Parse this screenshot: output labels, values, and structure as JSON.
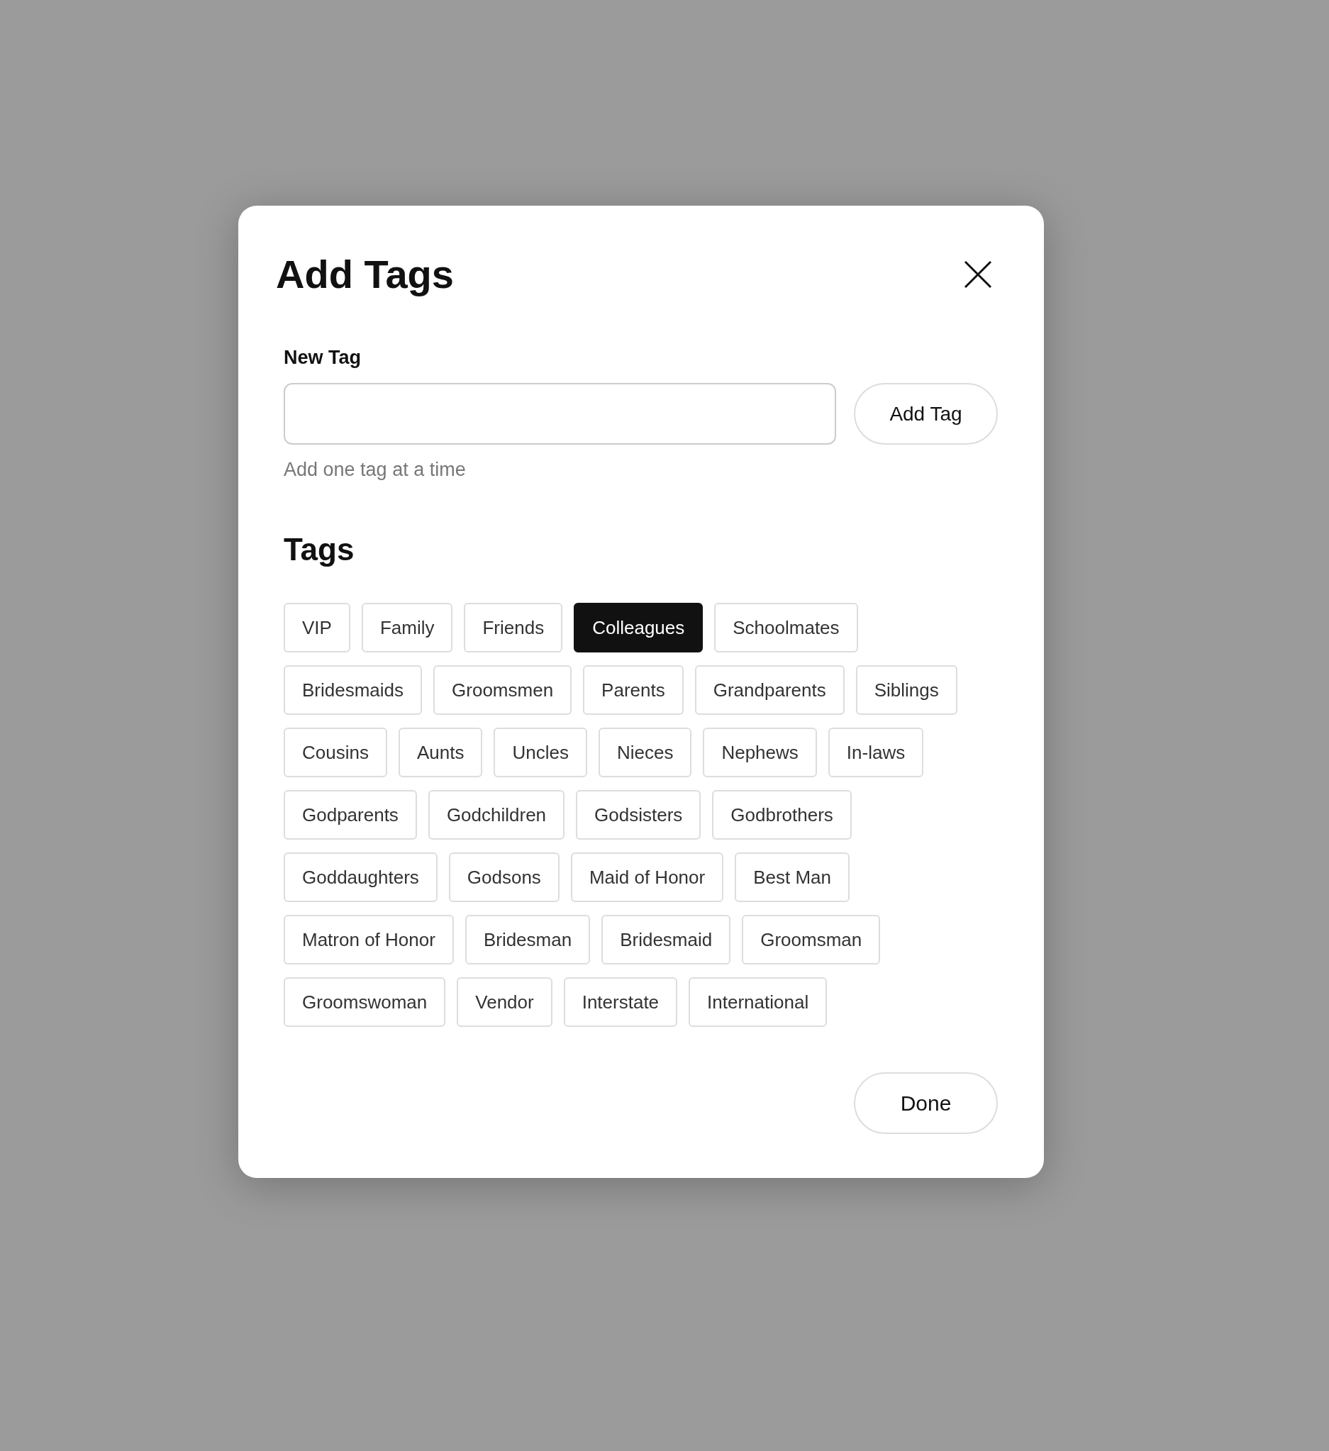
{
  "dialog": {
    "title": "Add Tags"
  },
  "new_tag": {
    "label": "New Tag",
    "button": "Add Tag",
    "hint": "Add one tag at a time"
  },
  "tags": {
    "heading": "Tags",
    "rows": [
      [
        {
          "label": "VIP",
          "selected": false
        },
        {
          "label": "Family",
          "selected": false
        },
        {
          "label": "Friends",
          "selected": false
        },
        {
          "label": "Colleagues",
          "selected": true
        },
        {
          "label": "Schoolmates",
          "selected": false
        }
      ],
      [
        {
          "label": "Bridesmaids",
          "selected": false
        },
        {
          "label": "Groomsmen",
          "selected": false
        },
        {
          "label": "Parents",
          "selected": false
        },
        {
          "label": "Grandparents",
          "selected": false
        },
        {
          "label": "Siblings",
          "selected": false
        }
      ],
      [
        {
          "label": "Cousins",
          "selected": false
        },
        {
          "label": "Aunts",
          "selected": false
        },
        {
          "label": "Uncles",
          "selected": false
        },
        {
          "label": "Nieces",
          "selected": false
        },
        {
          "label": "Nephews",
          "selected": false
        },
        {
          "label": "In-laws",
          "selected": false
        }
      ],
      [
        {
          "label": "Godparents",
          "selected": false
        },
        {
          "label": "Godchildren",
          "selected": false
        },
        {
          "label": "Godsisters",
          "selected": false
        },
        {
          "label": "Godbrothers",
          "selected": false
        }
      ],
      [
        {
          "label": "Goddaughters",
          "selected": false
        },
        {
          "label": "Godsons",
          "selected": false
        },
        {
          "label": "Maid of Honor",
          "selected": false
        },
        {
          "label": "Best Man",
          "selected": false
        }
      ],
      [
        {
          "label": "Matron of Honor",
          "selected": false
        },
        {
          "label": "Bridesman",
          "selected": false
        },
        {
          "label": "Bridesmaid",
          "selected": false
        },
        {
          "label": "Groomsman",
          "selected": false
        }
      ],
      [
        {
          "label": "Groomswoman",
          "selected": false
        },
        {
          "label": "Vendor",
          "selected": false
        },
        {
          "label": "Interstate",
          "selected": false
        },
        {
          "label": "International",
          "selected": false
        }
      ]
    ]
  },
  "footer": {
    "button": "Done"
  }
}
